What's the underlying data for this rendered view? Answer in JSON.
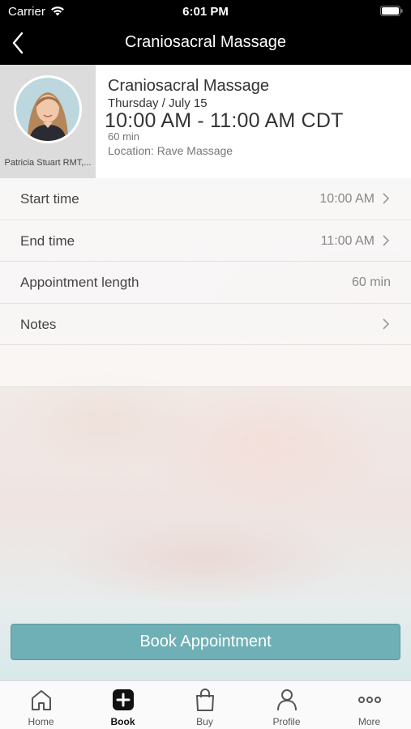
{
  "status_bar": {
    "carrier": "Carrier",
    "time": "6:01 PM"
  },
  "nav": {
    "title": "Craniosacral Massage"
  },
  "appointment": {
    "staff_name": "Patricia Stuart RMT,...",
    "service": "Craniosacral Massage",
    "date": "Thursday / July 15",
    "time_range": "10:00 AM - 11:00 AM CDT",
    "duration": "60 min",
    "location": "Location: Rave Massage"
  },
  "details": [
    {
      "label": "Start time",
      "value": "10:00 AM",
      "chevron": true
    },
    {
      "label": "End time",
      "value": "11:00 AM",
      "chevron": true
    },
    {
      "label": "Appointment length",
      "value": "60 min",
      "chevron": false
    },
    {
      "label": "Notes",
      "value": "",
      "chevron": true
    }
  ],
  "book_button": {
    "label": "Book Appointment"
  },
  "tabs": [
    {
      "label": "Home",
      "icon": "home-icon"
    },
    {
      "label": "Book",
      "icon": "book-plus-icon",
      "active": true
    },
    {
      "label": "Buy",
      "icon": "shopping-bag-icon"
    },
    {
      "label": "Profile",
      "icon": "person-icon"
    },
    {
      "label": "More",
      "icon": "more-dots-icon"
    }
  ],
  "colors": {
    "accent": "#6fb0b6",
    "nav_background": "#000000"
  }
}
